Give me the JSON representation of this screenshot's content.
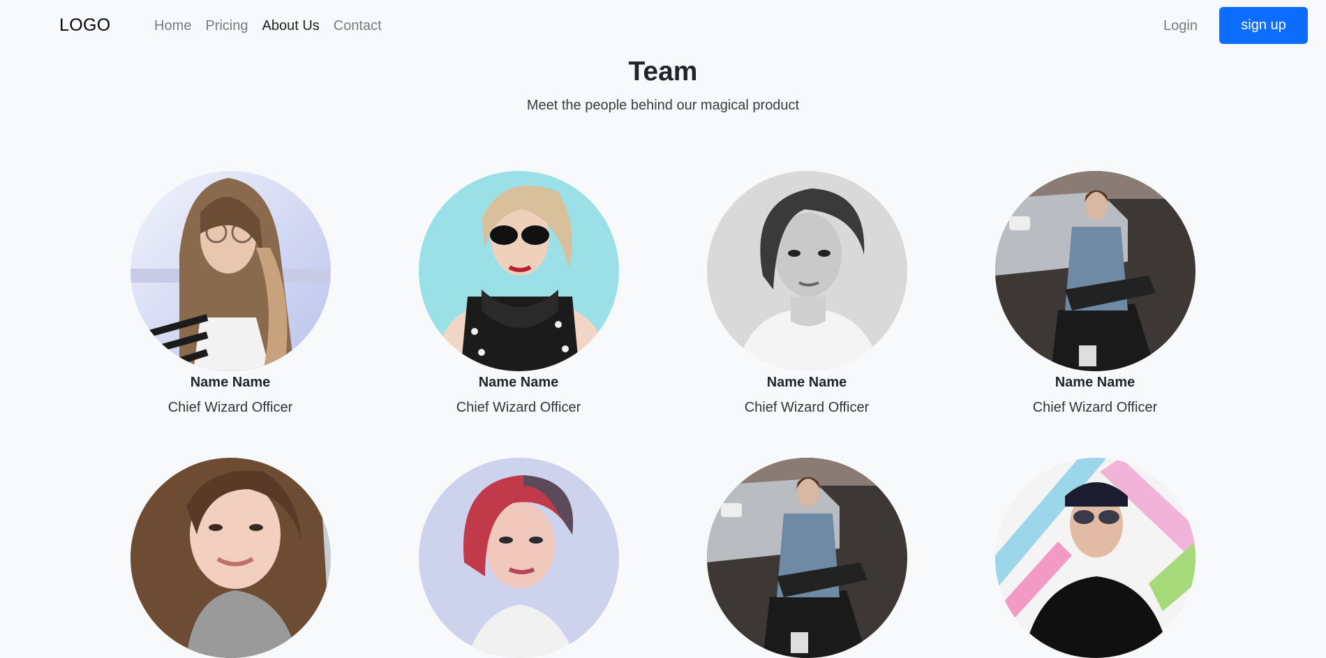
{
  "navbar": {
    "logo": "LOGO",
    "links": [
      {
        "label": "Home",
        "active": false
      },
      {
        "label": "Pricing",
        "active": false
      },
      {
        "label": "About Us",
        "active": true
      },
      {
        "label": "Contact",
        "active": false
      }
    ],
    "login_label": "Login",
    "signup_label": "sign up"
  },
  "header": {
    "title": "Team",
    "subtitle": "Meet the people behind our magical product"
  },
  "team": {
    "members": [
      {
        "name": "Name Name",
        "role": "Chief Wizard Officer"
      },
      {
        "name": "Name Name",
        "role": "Chief Wizard Officer"
      },
      {
        "name": "Name Name",
        "role": "Chief Wizard Officer"
      },
      {
        "name": "Name Name",
        "role": "Chief Wizard Officer"
      }
    ]
  },
  "colors": {
    "background": "#f8f9fa",
    "primary_button": "#0d6efd",
    "nav_text": "#7a7a7a",
    "nav_text_active": "#1f1f1f"
  }
}
